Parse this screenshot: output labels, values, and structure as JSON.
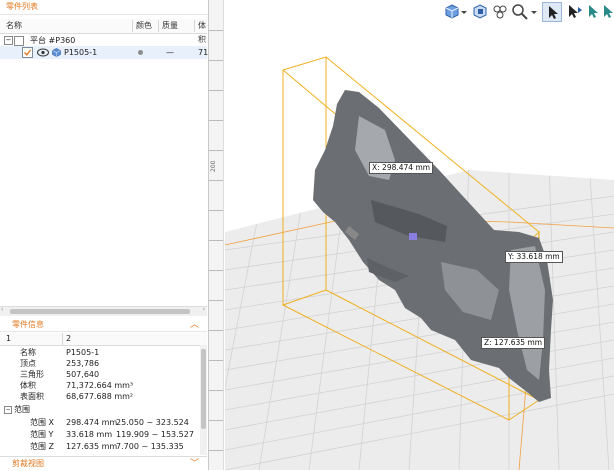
{
  "parts_list": {
    "title": "零件列表",
    "columns": {
      "name": "名称",
      "color": "颜色",
      "mass": "质量",
      "volume": "体积"
    },
    "platform": {
      "label": "平台 #P360"
    },
    "part": {
      "name": "P1505-1",
      "mass": "—",
      "volume": "71"
    }
  },
  "part_info": {
    "title": "零件信息",
    "col_index": "1",
    "col_value": "2",
    "rows": [
      {
        "label": "名称",
        "value": "P1505-1"
      },
      {
        "label": "顶点",
        "value": "253,786"
      },
      {
        "label": "三角形",
        "value": "507,640"
      },
      {
        "label": "体积",
        "value": "71,372.664 mm³"
      },
      {
        "label": "表面积",
        "value": "68,677.688 mm²"
      }
    ],
    "range_group": "范围",
    "ranges": [
      {
        "label": "范围 X",
        "size": "298.474 mm",
        "span": "25.050 ~ 323.524"
      },
      {
        "label": "范围 Y",
        "size": "33.618 mm",
        "span": "119.909 ~ 153.527"
      },
      {
        "label": "范围 Z",
        "size": "127.635 mm",
        "span": "7.700 ~ 135.335"
      }
    ]
  },
  "clip_view": {
    "title": "剪裁视图"
  },
  "viewport": {
    "ruler_label": "200",
    "measurements": {
      "x": "X: 298.474 mm",
      "y": "Y: 33.618 mm",
      "z": "Z: 127.635 mm"
    }
  },
  "toolbar": {
    "icons": [
      "view-cube-icon",
      "view-cube-dropdown-icon",
      "box-select-icon",
      "zoom-icon",
      "pointer-icon",
      "move-icon",
      "rotate-icon",
      "scale-icon"
    ]
  },
  "colors": {
    "accent": "#e07820",
    "bbox": "#f0b020",
    "platform_grid": "#d9d9d9",
    "model": "#6b6e73"
  }
}
